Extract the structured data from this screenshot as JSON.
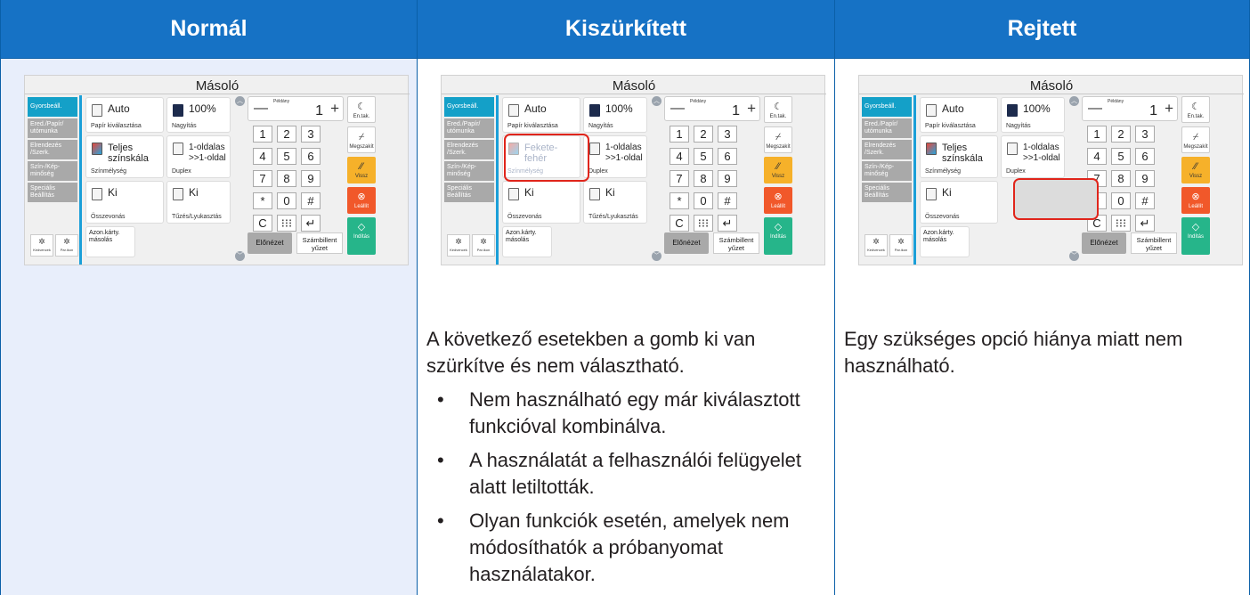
{
  "columns": [
    {
      "header": "Normál"
    },
    {
      "header": "Kiszürkített",
      "description": "A következő esetekben a gomb ki van szürkítve és nem választható.",
      "bullets": [
        "Nem használható egy már kiválasztott funkcióval kombinálva.",
        "A használatát a felhasználói felügyelet alatt letiltották.",
        "Olyan funkciók esetén, amelyek nem módosíthatók a próbanyomat használatakor."
      ]
    },
    {
      "header": "Rejtett",
      "description": "Egy szükséges opció hiánya miatt nem használható."
    }
  ],
  "panel": {
    "title": "Másoló",
    "nav": [
      "Gyorsbeáll.",
      "Ered./Papír/ utómunka",
      "Elrendezés /Szerk.",
      "Szín-/Kép- minőség",
      "Speciális Beállítás"
    ],
    "favorites": [
      "Kedvencek",
      "Par.ikon"
    ],
    "paper_value": "Auto",
    "paper_label": "Papír kiválasztása",
    "zoom_value": "100%",
    "zoom_label": "Nagyítás",
    "color_value": "Teljes színskála",
    "color_value_gray": "Fekete-fehér",
    "color_label": "Színmélység",
    "duplex_value": "1-oldalas >>1-oldal",
    "duplex_label": "Duplex",
    "combine_value": "Ki",
    "combine_label": "Összevonás",
    "staple_value": "Ki",
    "staple_label": "Tűzés/Lyukasztás",
    "idcard_label": "Azon.kárty. másolás",
    "copies_label": "Példány",
    "copies_value": "1",
    "keys": [
      "1",
      "2",
      "3",
      "4",
      "5",
      "6",
      "7",
      "8",
      "9",
      "*",
      "0",
      "#",
      "C",
      "⁝⁝⁝",
      "↵"
    ],
    "side": [
      "En.tak.",
      "Megszakít",
      "Vissz",
      "Leállít",
      "Indítás"
    ],
    "preview": "Előnézet",
    "counter_btn": "Számbillent yűzet"
  }
}
